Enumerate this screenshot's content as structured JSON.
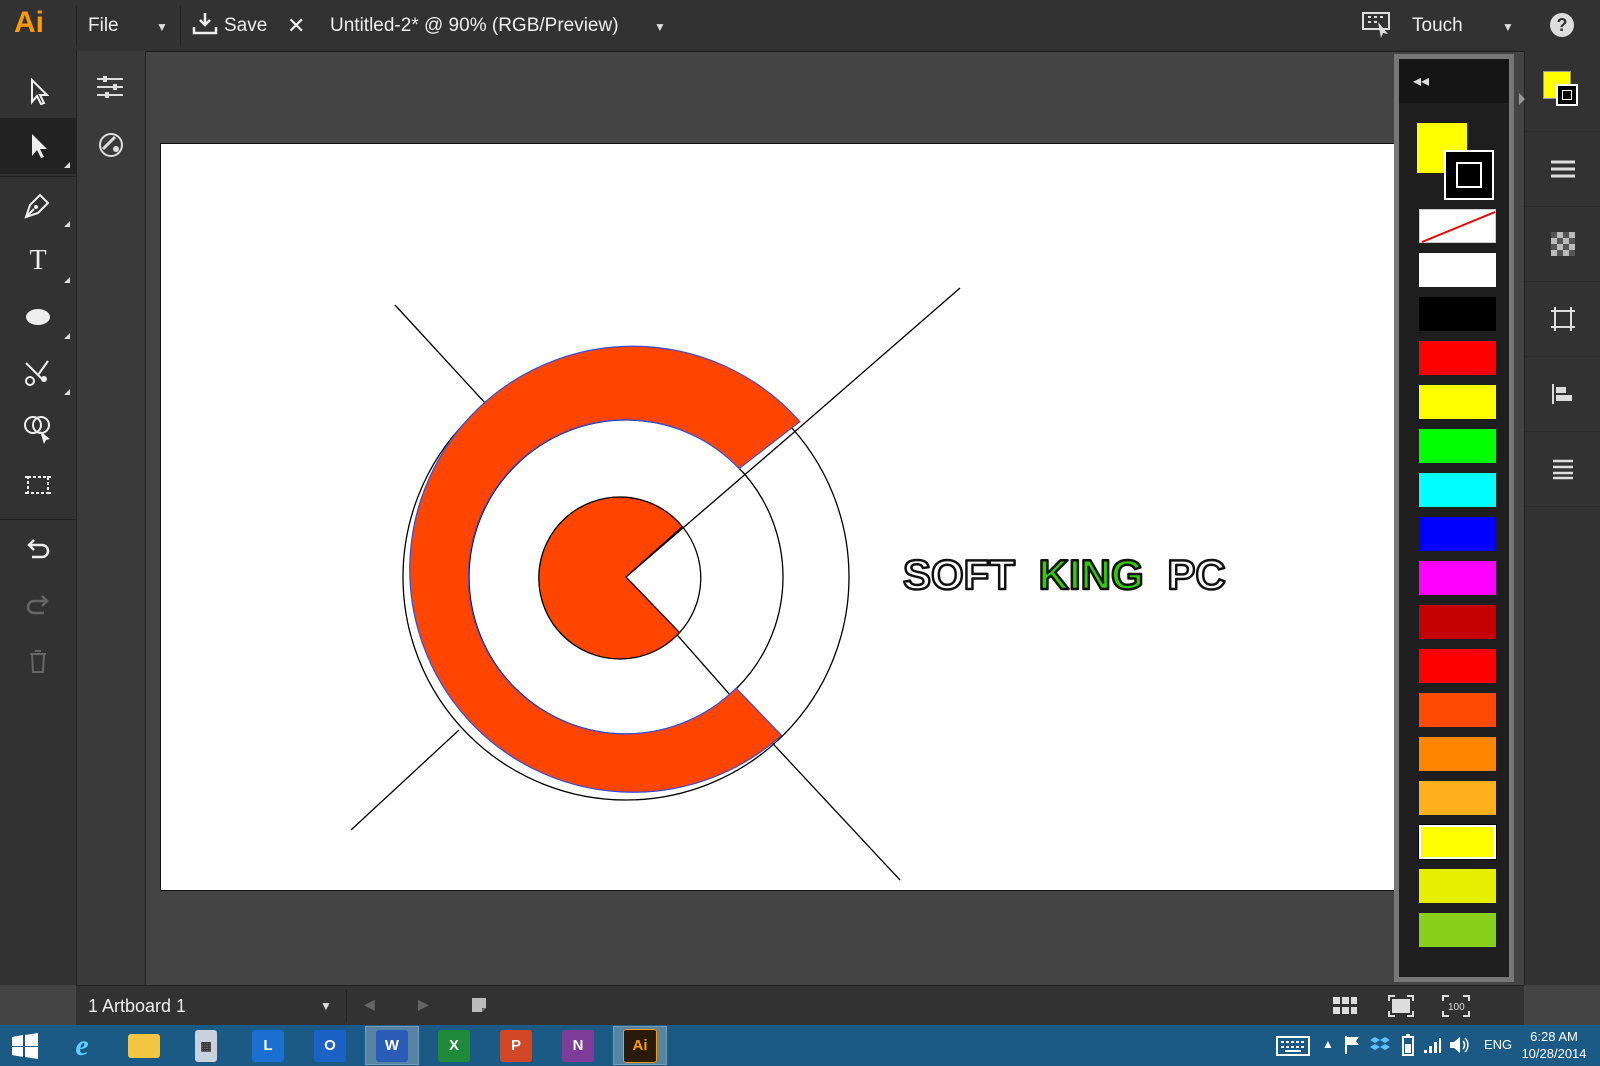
{
  "app": {
    "logo": "Ai",
    "file_menu": "File",
    "save": "Save",
    "doc_title": "Untitled-2* @ 90% (RGB/Preview)",
    "workspace": "Touch"
  },
  "artwork": {
    "word1": "SOFT",
    "word2": "KING",
    "word3": "PC",
    "fill_color": "#ff4500",
    "accent_green": "#33cc00"
  },
  "swatches": [
    "none",
    "#ffffff",
    "#000000",
    "#ff0000",
    "#ffff00",
    "#00ff00",
    "#00ffff",
    "#0000ff",
    "#ff00ff",
    "#c40000",
    "#ff0000",
    "#ff4a00",
    "#ff8400",
    "#ffb01a",
    "#ffff00",
    "#e6ef00",
    "#88d01c"
  ],
  "selected_swatch_index": 14,
  "fill_stroke": {
    "fill": "#ffff00",
    "stroke": "#000000"
  },
  "bottom": {
    "artboard_select": "1 Artboard 1"
  },
  "taskbar": {
    "apps": [
      "Internet Explorer",
      "File Explorer",
      "Calculator",
      "Lync",
      "Outlook",
      "Word",
      "Excel",
      "PowerPoint",
      "OneNote",
      "Illustrator"
    ],
    "lang": "ENG",
    "time": "6:28 AM",
    "date": "10/28/2014"
  }
}
